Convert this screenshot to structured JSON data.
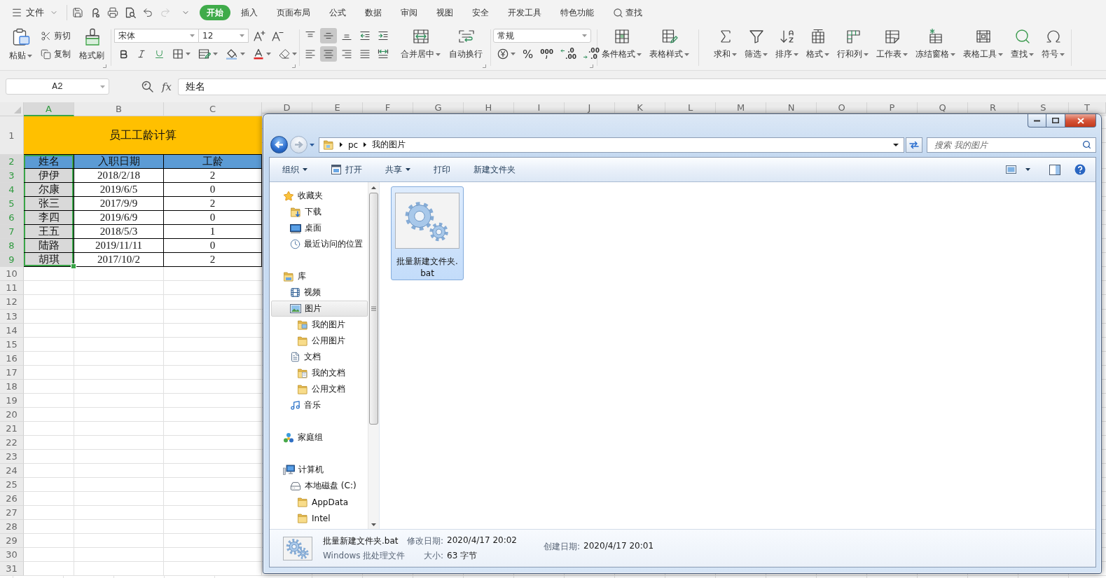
{
  "menu_bar": {
    "file_menu": "文件",
    "quick_access": [
      {
        "kind": "save",
        "disabled": false
      },
      {
        "kind": "loop",
        "disabled": false
      },
      {
        "kind": "print",
        "disabled": false
      },
      {
        "kind": "preview",
        "disabled": false
      },
      {
        "kind": "undo",
        "disabled": false
      },
      {
        "kind": "redo",
        "disabled": true
      }
    ],
    "tabs": [
      {
        "label": "开始",
        "selected": true
      },
      {
        "label": "插入",
        "selected": false
      },
      {
        "label": "页面布局",
        "selected": false
      },
      {
        "label": "公式",
        "selected": false
      },
      {
        "label": "数据",
        "selected": false
      },
      {
        "label": "审阅",
        "selected": false
      },
      {
        "label": "视图",
        "selected": false
      },
      {
        "label": "安全",
        "selected": false
      },
      {
        "label": "开发工具",
        "selected": false
      },
      {
        "label": "特色功能",
        "selected": false
      }
    ],
    "search": "查找"
  },
  "ribbon": {
    "clipboard": {
      "paste": "粘贴",
      "cut": "剪切",
      "copy": "复制",
      "format_painter": "格式刷"
    },
    "font": {
      "name": "宋体",
      "size": "12"
    },
    "alignment": [
      {
        "kind": "top",
        "selected": false
      },
      {
        "kind": "middle",
        "selected": true
      },
      {
        "kind": "bottom",
        "selected": false
      },
      {
        "kind": "outdent",
        "selected": false
      },
      {
        "kind": "indent",
        "selected": false
      },
      {
        "kind": "left",
        "selected": false
      },
      {
        "kind": "center",
        "selected": true
      },
      {
        "kind": "right",
        "selected": false
      },
      {
        "kind": "justify",
        "selected": false
      },
      {
        "kind": "distributed",
        "selected": false
      }
    ],
    "merge_center": "合并居中",
    "wrap_text": "自动换行",
    "number": {
      "format": "常规",
      "percent": "%",
      "thousands": "000",
      "decimals": [
        {
          "kind": "increase",
          "top": ".0",
          "bottom": ".00"
        },
        {
          "kind": "decrease",
          "top": ".00",
          "bottom": ".0"
        }
      ]
    },
    "styles": [
      {
        "label": "条件格式",
        "kind": "conditional"
      },
      {
        "label": "表格样式",
        "kind": "table-style"
      }
    ],
    "tools": [
      {
        "label": "求和",
        "kind": "sum"
      },
      {
        "label": "筛选",
        "kind": "filter"
      },
      {
        "label": "排序",
        "kind": "sort"
      },
      {
        "label": "格式",
        "kind": "format"
      },
      {
        "label": "行和列",
        "kind": "rows-columns"
      },
      {
        "label": "工作表",
        "kind": "worksheet"
      },
      {
        "label": "冻结窗格",
        "kind": "freeze"
      },
      {
        "label": "表格工具",
        "kind": "table-tools"
      },
      {
        "label": "查找",
        "kind": "find"
      },
      {
        "label": "符号",
        "kind": "symbol"
      }
    ]
  },
  "formula_bar": {
    "name_box": "A2",
    "fx": "fx",
    "value": "姓名"
  },
  "sheet": {
    "columns": [
      {
        "label": "A",
        "selected": true
      },
      {
        "label": "B",
        "selected": false
      },
      {
        "label": "C",
        "selected": false
      },
      {
        "label": "D",
        "selected": false
      },
      {
        "label": "E",
        "selected": false
      },
      {
        "label": "F",
        "selected": false
      },
      {
        "label": "G",
        "selected": false
      },
      {
        "label": "H",
        "selected": false
      },
      {
        "label": "I",
        "selected": false
      },
      {
        "label": "J",
        "selected": false
      },
      {
        "label": "K",
        "selected": false
      },
      {
        "label": "L",
        "selected": false
      },
      {
        "label": "M",
        "selected": false
      },
      {
        "label": "N",
        "selected": false
      },
      {
        "label": "O",
        "selected": false
      },
      {
        "label": "P",
        "selected": false
      },
      {
        "label": "Q",
        "selected": false
      },
      {
        "label": "R",
        "selected": false
      },
      {
        "label": "S",
        "selected": false
      },
      {
        "label": "T",
        "selected": false
      }
    ],
    "rows": [
      {
        "label": "1",
        "selected": false
      },
      {
        "label": "2",
        "selected": true
      },
      {
        "label": "3",
        "selected": true
      },
      {
        "label": "4",
        "selected": true
      },
      {
        "label": "5",
        "selected": true
      },
      {
        "label": "6",
        "selected": true
      },
      {
        "label": "7",
        "selected": true
      },
      {
        "label": "8",
        "selected": true
      },
      {
        "label": "9",
        "selected": true
      },
      {
        "label": "10",
        "selected": false
      },
      {
        "label": "11",
        "selected": false
      },
      {
        "label": "12",
        "selected": false
      },
      {
        "label": "13",
        "selected": false
      },
      {
        "label": "14",
        "selected": false
      },
      {
        "label": "15",
        "selected": false
      },
      {
        "label": "16",
        "selected": false
      },
      {
        "label": "17",
        "selected": false
      },
      {
        "label": "18",
        "selected": false
      },
      {
        "label": "19",
        "selected": false
      },
      {
        "label": "20",
        "selected": false
      },
      {
        "label": "21",
        "selected": false
      },
      {
        "label": "22",
        "selected": false
      },
      {
        "label": "23",
        "selected": false
      },
      {
        "label": "24",
        "selected": false
      },
      {
        "label": "25",
        "selected": false
      },
      {
        "label": "26",
        "selected": false
      },
      {
        "label": "27",
        "selected": false
      },
      {
        "label": "28",
        "selected": false
      },
      {
        "label": "29",
        "selected": false
      },
      {
        "label": "30",
        "selected": false
      },
      {
        "label": "31",
        "selected": false
      }
    ],
    "title": "员工工龄计算",
    "header": [
      {
        "text": "姓名",
        "active": true
      },
      {
        "text": "入职日期",
        "active": false
      },
      {
        "text": "工龄",
        "active": false
      }
    ],
    "records": [
      [
        {
          "text": "伊伊",
          "selected": true
        },
        {
          "text": "2018/2/18",
          "selected": false
        },
        {
          "text": "2",
          "selected": false
        }
      ],
      [
        {
          "text": "尔康",
          "selected": true
        },
        {
          "text": "2019/6/5",
          "selected": false
        },
        {
          "text": "0",
          "selected": false
        }
      ],
      [
        {
          "text": "张三",
          "selected": true
        },
        {
          "text": "2017/9/9",
          "selected": false
        },
        {
          "text": "2",
          "selected": false
        }
      ],
      [
        {
          "text": "李四",
          "selected": true
        },
        {
          "text": "2019/6/9",
          "selected": false
        },
        {
          "text": "0",
          "selected": false
        }
      ],
      [
        {
          "text": "王五",
          "selected": true
        },
        {
          "text": "2018/5/3",
          "selected": false
        },
        {
          "text": "1",
          "selected": false
        }
      ],
      [
        {
          "text": "陆路",
          "selected": true
        },
        {
          "text": "2019/11/11",
          "selected": false
        },
        {
          "text": "0",
          "selected": false
        }
      ],
      [
        {
          "text": "胡琪",
          "selected": true
        },
        {
          "text": "2017/10/2",
          "selected": false
        },
        {
          "text": "2",
          "selected": false
        }
      ]
    ]
  },
  "explorer": {
    "back": {
      "disabled": false
    },
    "forward": {
      "disabled": true
    },
    "address": [
      "pc",
      "我的图片"
    ],
    "search": {
      "placeholder": "搜索 我的图片"
    },
    "toolbar": [
      {
        "label": "组织",
        "kind": "menu"
      },
      {
        "label": "打开",
        "kind": "open"
      },
      {
        "label": "共享",
        "kind": "menu"
      },
      {
        "label": "打印",
        "kind": "plain"
      },
      {
        "label": "新建文件夹",
        "kind": "plain"
      }
    ],
    "nav_pane": [
      {
        "label": "收藏夹",
        "kind": "favorites",
        "selected": false,
        "children": [
          {
            "label": "下载",
            "kind": "downloads",
            "selected": false
          },
          {
            "label": "桌面",
            "kind": "desktop",
            "selected": false
          },
          {
            "label": "最近访问的位置",
            "kind": "recent",
            "selected": false
          }
        ]
      },
      {
        "label": "库",
        "kind": "libraries",
        "selected": false,
        "children": [
          {
            "label": "视频",
            "kind": "videos",
            "selected": false
          },
          {
            "label": "图片",
            "kind": "pictures",
            "selected": true,
            "children": [
              {
                "label": "我的图片",
                "kind": "picture-folder",
                "selected": false
              },
              {
                "label": "公用图片",
                "kind": "folder",
                "selected": false
              }
            ]
          },
          {
            "label": "文档",
            "kind": "documents",
            "selected": false,
            "children": [
              {
                "label": "我的文档",
                "kind": "document-folder",
                "selected": false
              },
              {
                "label": "公用文档",
                "kind": "folder",
                "selected": false
              }
            ]
          },
          {
            "label": "音乐",
            "kind": "music",
            "selected": false
          }
        ]
      },
      {
        "label": "家庭组",
        "kind": "homegroup",
        "selected": false
      },
      {
        "label": "计算机",
        "kind": "computer",
        "selected": false,
        "children": [
          {
            "label": "本地磁盘 (C:)",
            "kind": "drive",
            "selected": false,
            "children": [
              {
                "label": "AppData",
                "kind": "folder",
                "selected": false
              },
              {
                "label": "Intel",
                "kind": "folder",
                "selected": false
              }
            ]
          }
        ]
      }
    ],
    "files": [
      {
        "name": "批量新建文件夹.bat",
        "selected": true
      }
    ],
    "details": {
      "name": "批量新建文件夹.bat",
      "type": "Windows 批处理文件",
      "fields": [
        {
          "label": "修改日期:",
          "value": "2020/4/17 20:02"
        },
        {
          "label": "大小:",
          "value": "63 字节"
        },
        {
          "label": "创建日期:",
          "value": "2020/4/17 20:01"
        }
      ]
    }
  }
}
